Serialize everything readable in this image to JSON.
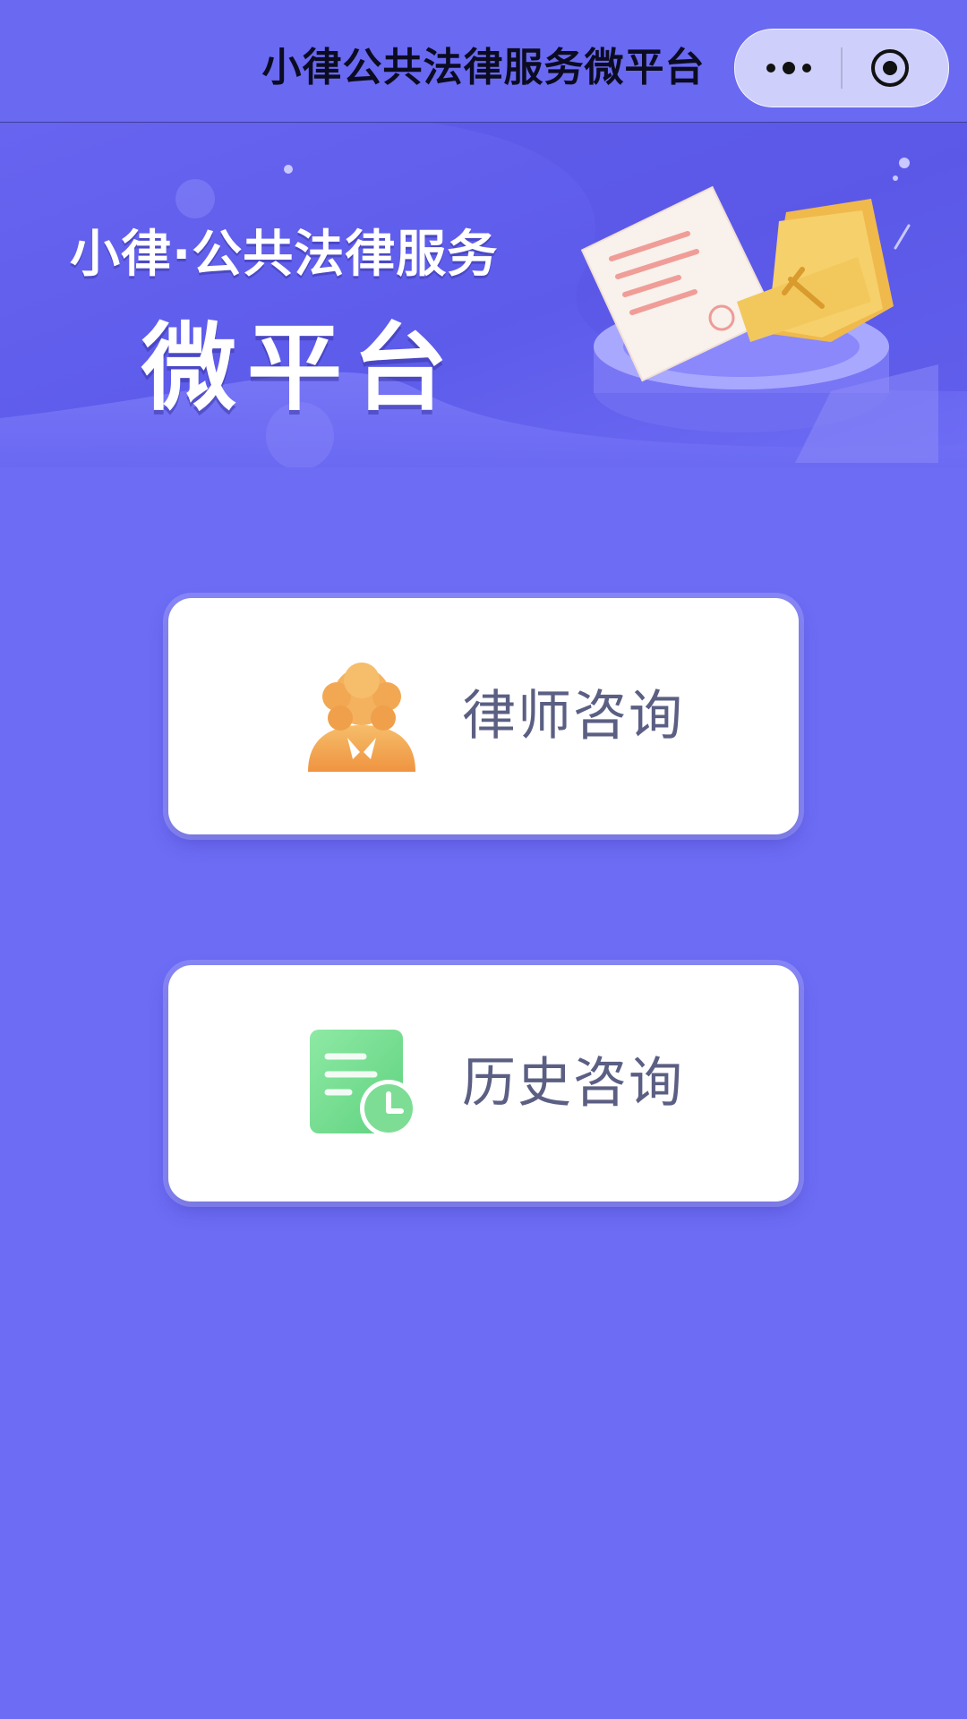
{
  "nav": {
    "title": "小律公共法律服务微平台"
  },
  "banner": {
    "line1": "小律·公共法律服务",
    "line2": "微平台"
  },
  "actions": [
    {
      "label": "律师咨询",
      "icon": "lawyer-icon"
    },
    {
      "label": "历史咨询",
      "icon": "history-document-icon"
    }
  ],
  "colors": {
    "background": "#6d6cf5",
    "card": "#ffffff",
    "card_text": "#5b5f83",
    "lawyer_icon": "#f1a14b",
    "history_icon": "#6ad98a"
  }
}
